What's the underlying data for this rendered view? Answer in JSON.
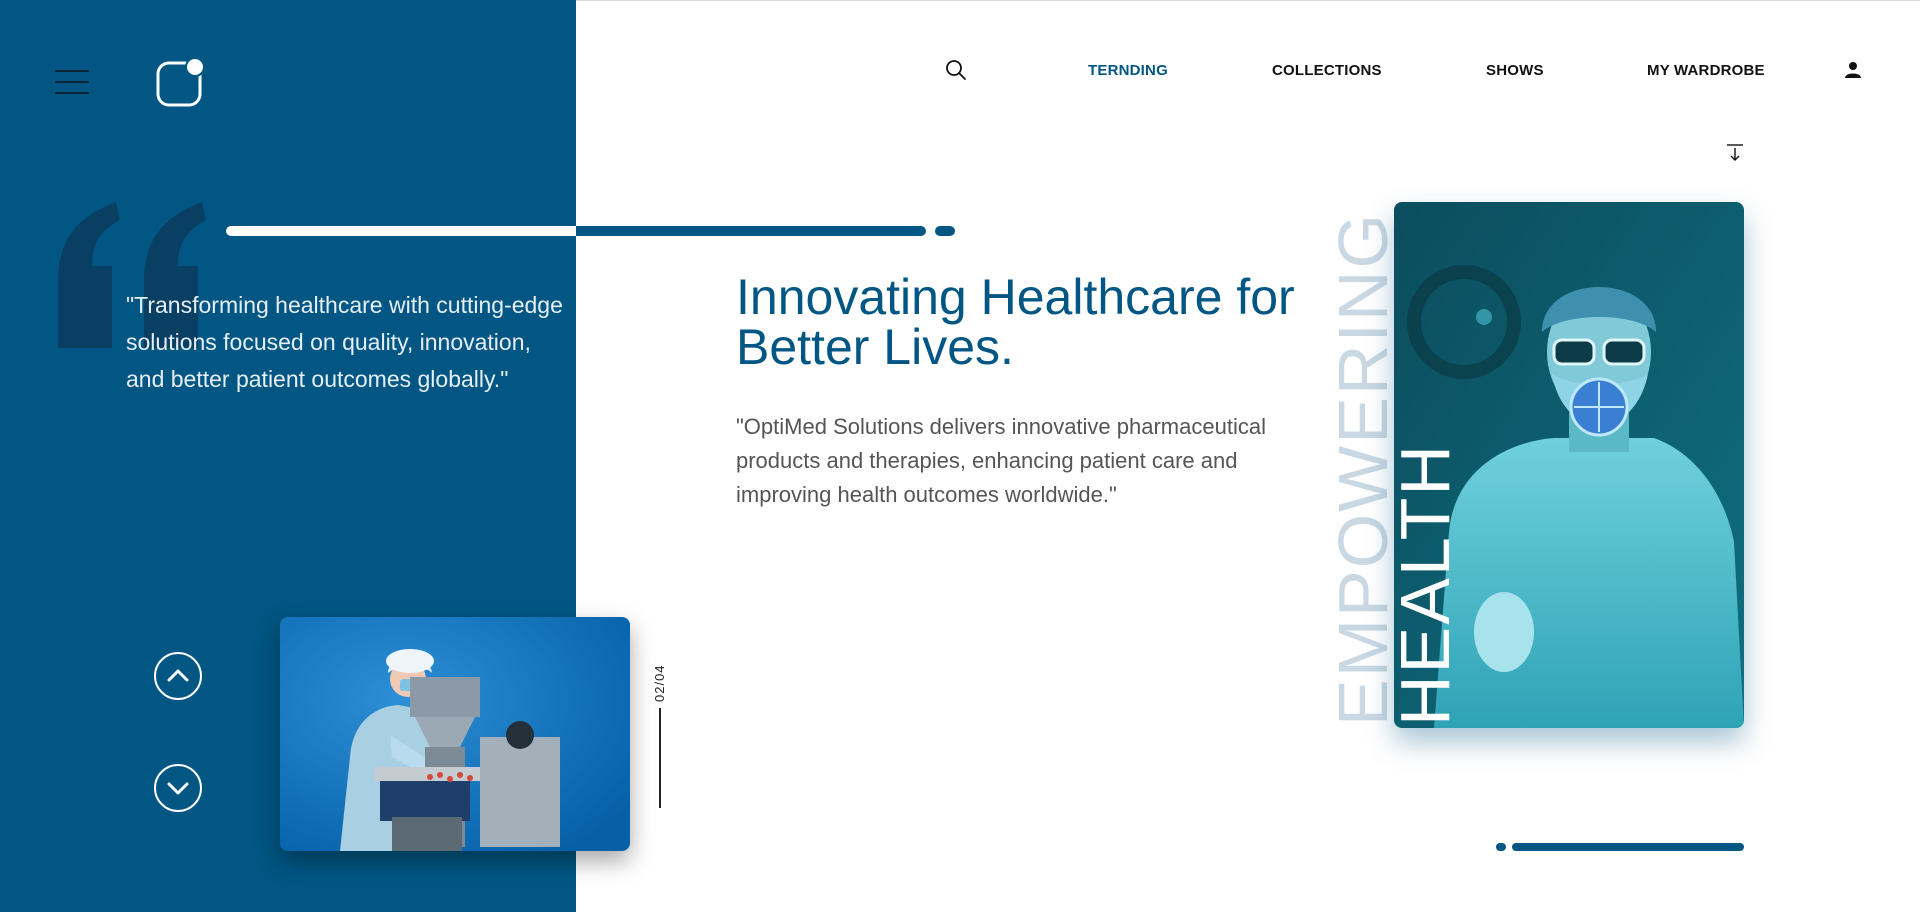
{
  "nav": {
    "items": [
      {
        "label": "TERNDING",
        "active": true
      },
      {
        "label": "COLLECTIONS",
        "active": false
      },
      {
        "label": "SHOWS",
        "active": false
      },
      {
        "label": "MY WARDROBE",
        "active": false
      }
    ],
    "icons": [
      "search-icon",
      "user-icon",
      "download-icon"
    ]
  },
  "sidebar": {
    "icons": [
      "hamburger-menu-icon",
      "logo-icon",
      "quote-mark-icon",
      "chevron-up-icon",
      "chevron-down-icon"
    ],
    "quote": "\"Transforming healthcare with cutting-edge solutions focused on quality, innovation, and better patient outcomes globally.\""
  },
  "hero": {
    "headline": "Innovating Healthcare for Better Lives.",
    "description": "\"OptiMed Solutions delivers innovative pharmaceutical products and therapies, enhancing patient care and improving health outcomes worldwide.\"",
    "vertical_text_1": "EMPOWERING",
    "vertical_text_2": "HEALTH"
  },
  "slider": {
    "counter": "02/04"
  },
  "colors": {
    "brand": "#015683",
    "panel": "#015683",
    "light_text": "#c9d8e3",
    "body_text": "#555555"
  }
}
